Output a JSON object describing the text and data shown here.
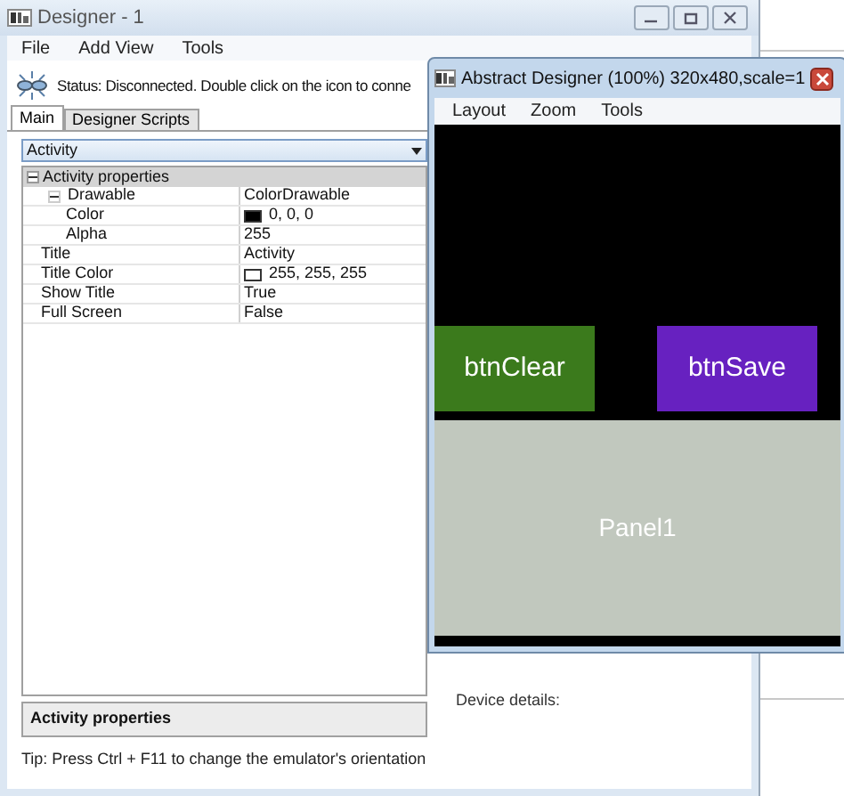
{
  "main_window": {
    "title": "Designer - 1",
    "menu": [
      "File",
      "Add View",
      "Tools"
    ],
    "status": "Status: Disconnected. Double click on the icon to conne",
    "tabs": [
      {
        "label": "Main",
        "selected": true
      },
      {
        "label": "Designer Scripts",
        "selected": false
      }
    ],
    "module_select": "Activity",
    "properties": {
      "category": "Activity properties",
      "expanded": true,
      "rows": [
        {
          "name": "Drawable",
          "value": "ColorDrawable",
          "expanded": true,
          "children": [
            {
              "name": "Color",
              "value": "0, 0, 0",
              "color": "#000000"
            },
            {
              "name": "Alpha",
              "value": "255"
            }
          ]
        },
        {
          "name": "Title",
          "value": "Activity"
        },
        {
          "name": "Title Color",
          "value": "255, 255, 255",
          "color": "#ffffff"
        },
        {
          "name": "Show Title",
          "value": "True"
        },
        {
          "name": "Full Screen",
          "value": "False"
        }
      ]
    },
    "description_title": "Activity properties",
    "device_details": "Device details:",
    "tip": "Tip: Press Ctrl + F11 to change the emulator's orientation"
  },
  "designer_window": {
    "title": "Abstract Designer (100%) 320x480,scale=1",
    "menu": [
      "Layout",
      "Zoom",
      "Tools"
    ],
    "views": [
      {
        "kind": "button",
        "text": "btnClear",
        "color": "#3b7a1c"
      },
      {
        "kind": "button",
        "text": "btnSave",
        "color": "#6721c0"
      }
    ],
    "panel": {
      "text": "Panel1"
    }
  }
}
